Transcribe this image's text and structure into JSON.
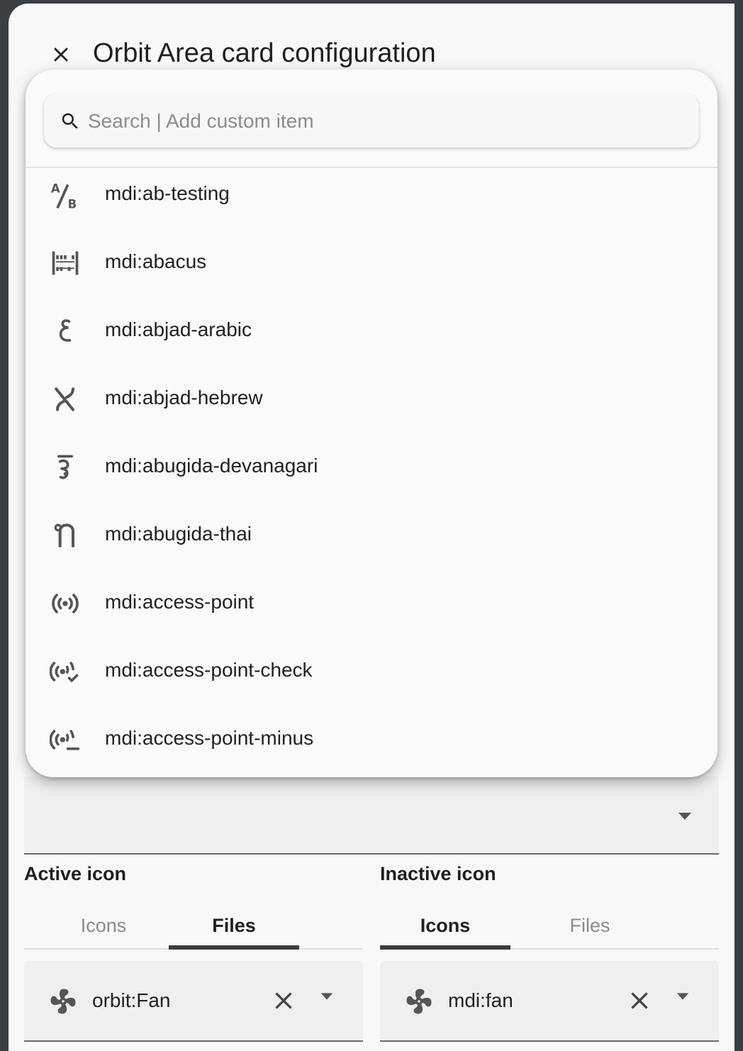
{
  "dialog": {
    "title": "Orbit Area card configuration"
  },
  "search": {
    "placeholder": "Search | Add custom item",
    "value": ""
  },
  "icon_list": [
    {
      "label": "mdi:ab-testing",
      "icon": "ab-testing-icon"
    },
    {
      "label": "mdi:abacus",
      "icon": "abacus-icon"
    },
    {
      "label": "mdi:abjad-arabic",
      "icon": "abjad-arabic-icon"
    },
    {
      "label": "mdi:abjad-hebrew",
      "icon": "abjad-hebrew-icon"
    },
    {
      "label": "mdi:abugida-devanagari",
      "icon": "abugida-devanagari-icon"
    },
    {
      "label": "mdi:abugida-thai",
      "icon": "abugida-thai-icon"
    },
    {
      "label": "mdi:access-point",
      "icon": "access-point-icon"
    },
    {
      "label": "mdi:access-point-check",
      "icon": "access-point-check-icon"
    },
    {
      "label": "mdi:access-point-minus",
      "icon": "access-point-minus-icon"
    }
  ],
  "active_icon": {
    "label": "Active icon",
    "tabs": [
      "Icons",
      "Files"
    ],
    "selected_tab": "Files",
    "value": "orbit:Fan"
  },
  "inactive_icon": {
    "label": "Inactive icon",
    "tabs": [
      "Icons",
      "Files"
    ],
    "selected_tab": "Icons",
    "value": "mdi:fan"
  },
  "colors": {
    "scrim": "#3a3f44",
    "surface": "#f8f8f8",
    "tab_indicator": "#3c3c3c"
  }
}
